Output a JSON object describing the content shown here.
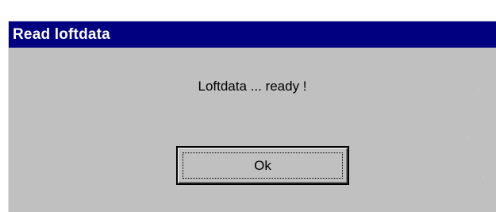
{
  "window": {
    "title": "Read loftdata"
  },
  "dialog": {
    "message": "Loftdata ... ready !",
    "ok_label": "Ok"
  },
  "colors": {
    "titlebar": "#000080",
    "face": "#c0c0c0",
    "title_text": "#ffffff"
  }
}
